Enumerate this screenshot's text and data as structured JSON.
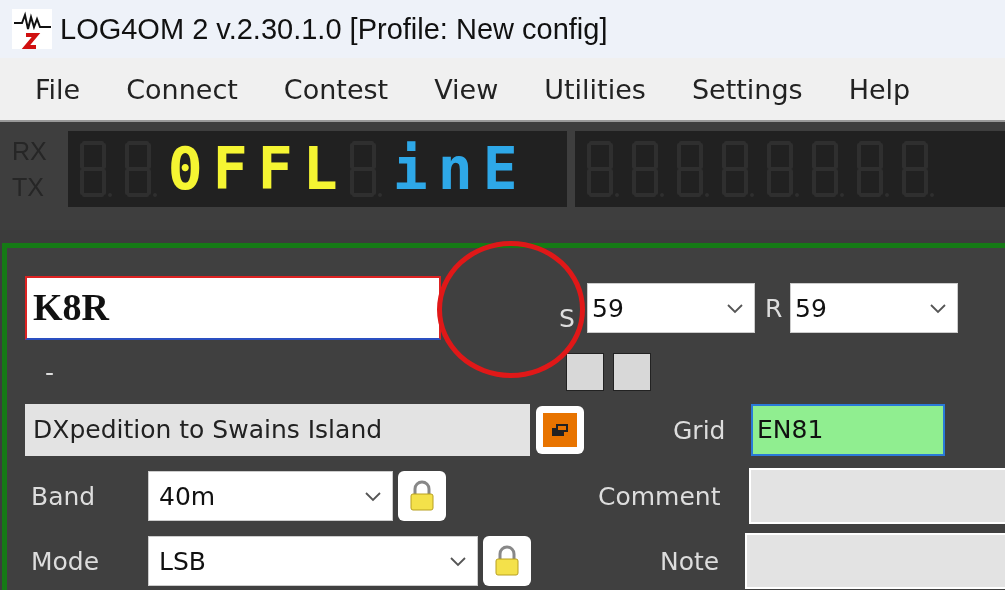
{
  "window": {
    "title": "LOG4OM 2 v.2.30.1.0 [Profile: New config]"
  },
  "menu": [
    "File",
    "Connect",
    "Contest",
    "View",
    "Utilities",
    "Settings",
    "Help"
  ],
  "radio_display": {
    "rx_label": "RX",
    "tx_label": "TX",
    "cells": [
      {
        "kind": "unlit"
      },
      {
        "kind": "unlit"
      },
      {
        "kind": "lit",
        "char": "0",
        "color": "#f5f532"
      },
      {
        "kind": "lit",
        "char": "F",
        "color": "#f5f532"
      },
      {
        "kind": "lit",
        "char": "F",
        "color": "#f5f532"
      },
      {
        "kind": "lit",
        "char": "L",
        "color": "#f5f532"
      },
      {
        "kind": "unlit"
      },
      {
        "kind": "lit",
        "char": "i",
        "color": "#2ea8e8"
      },
      {
        "kind": "lit",
        "char": "n",
        "color": "#2ea8e8"
      },
      {
        "kind": "lit",
        "char": "E",
        "color": "#2ea8e8"
      }
    ],
    "frequency_cells": [
      {
        "kind": "unlit"
      },
      {
        "kind": "unlit"
      },
      {
        "kind": "unlit"
      },
      {
        "kind": "unlit"
      },
      {
        "kind": "unlit"
      },
      {
        "kind": "unlit"
      },
      {
        "kind": "unlit"
      },
      {
        "kind": "unlit"
      }
    ]
  },
  "qso": {
    "callsign": "K8R",
    "sent": {
      "label": "S",
      "value": "59"
    },
    "received": {
      "label": "R",
      "value": "59"
    },
    "name_line": "-",
    "entity": "DXpedition to Swains Island",
    "grid": {
      "label": "Grid",
      "value": "EN81"
    },
    "band": {
      "label": "Band",
      "value": "40m",
      "locked": true
    },
    "mode": {
      "label": "Mode",
      "value": "LSB",
      "locked": true
    },
    "comment": {
      "label": "Comment"
    },
    "note": {
      "label": "Note"
    }
  }
}
